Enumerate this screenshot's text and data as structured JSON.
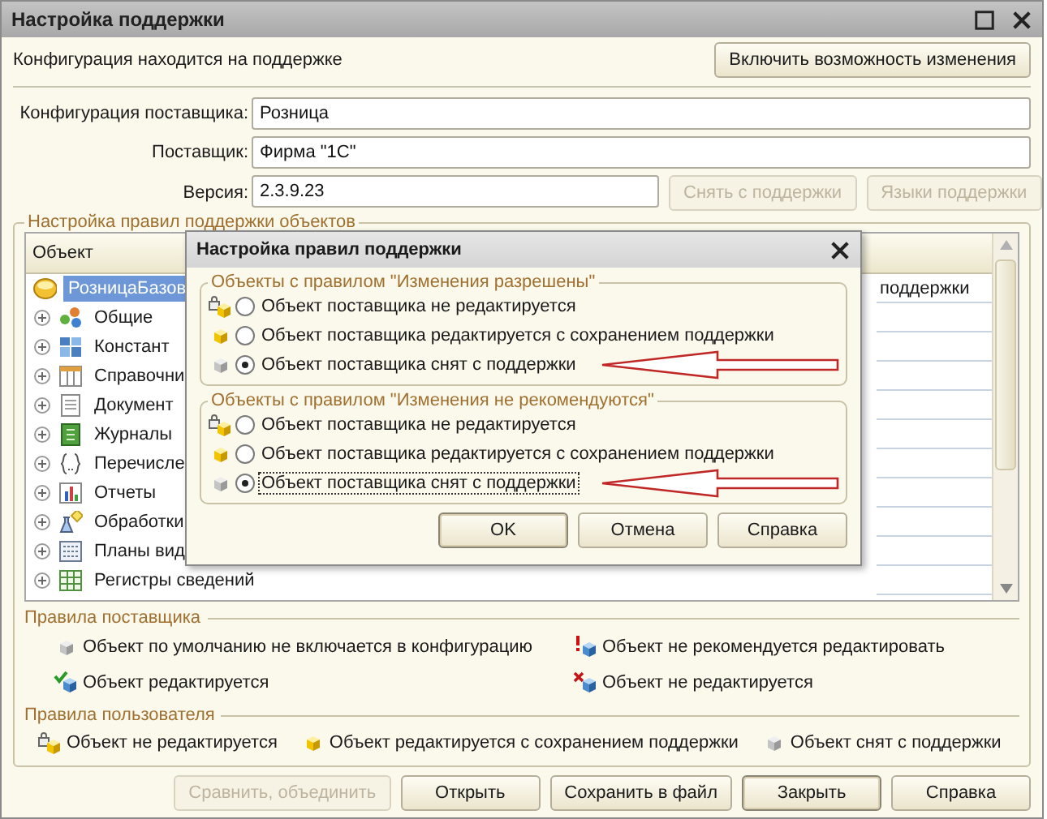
{
  "window": {
    "title": "Настройка поддержки"
  },
  "status_text": "Конфигурация находится на поддержке",
  "enable_button": "Включить возможность изменения",
  "fields": [
    {
      "label": "Конфигурация поставщика:",
      "value": "Розница"
    },
    {
      "label": "Поставщик:",
      "value": "Фирма \"1С\""
    },
    {
      "label": "Версия:",
      "value": "2.3.9.23"
    }
  ],
  "version_buttons": [
    {
      "label": "Снять с поддержки",
      "disabled": true
    },
    {
      "label": "Языки поддержки",
      "disabled": true
    }
  ],
  "rules_group": {
    "title": "Настройка правил поддержки объектов",
    "tree": {
      "columns": [
        "Объект"
      ],
      "rows": [
        {
          "kind": "root",
          "text": "РозницаБазов",
          "column_2": "поддержки",
          "expandable": false,
          "selected": true
        },
        {
          "kind": "common",
          "text": "Общие",
          "expandable": true,
          "selected": false
        },
        {
          "kind": "constants",
          "text": "Констант",
          "expandable": true,
          "selected": false
        },
        {
          "kind": "catalogs",
          "text": "Справочни",
          "expandable": true,
          "selected": false
        },
        {
          "kind": "documents",
          "text": "Документ",
          "expandable": true,
          "selected": false
        },
        {
          "kind": "journals",
          "text": "Журналы",
          "expandable": true,
          "selected": false
        },
        {
          "kind": "enums",
          "text": "Перечисле",
          "expandable": true,
          "selected": false
        },
        {
          "kind": "reports",
          "text": "Отчеты",
          "expandable": true,
          "selected": false
        },
        {
          "kind": "processors",
          "text": "Обработки",
          "expandable": true,
          "selected": false
        },
        {
          "kind": "chart_types",
          "text": "Планы вид",
          "expandable": true,
          "selected": false
        },
        {
          "kind": "registers",
          "text": "Регистры сведений",
          "expandable": true,
          "selected": false
        }
      ]
    },
    "supplier_rules": {
      "title": "Правила поставщика",
      "items": [
        {
          "kind": "excluded",
          "text": "Объект по умолчанию не включается в конфигурацию"
        },
        {
          "kind": "not_recommended",
          "text": "Объект не рекомендуется редактировать"
        },
        {
          "kind": "editable",
          "text": "Объект редактируется"
        },
        {
          "kind": "not_editable",
          "text": "Объект не редактируется"
        }
      ]
    },
    "user_rules": {
      "title": "Правила пользователя",
      "items": [
        {
          "kind": "locked",
          "text": "Объект не редактируется"
        },
        {
          "kind": "kept",
          "text": "Объект редактируется с сохранением поддержки"
        },
        {
          "kind": "removed",
          "text": "Объект снят с поддержки"
        }
      ]
    }
  },
  "footer_buttons": [
    {
      "label": "Сравнить, объединить",
      "disabled": true,
      "default": false
    },
    {
      "label": "Открыть",
      "disabled": false,
      "default": false
    },
    {
      "label": "Сохранить в файл",
      "disabled": false,
      "default": false
    },
    {
      "label": "Закрыть",
      "disabled": false,
      "default": true
    },
    {
      "label": "Справка",
      "disabled": false,
      "default": false
    }
  ],
  "dialog": {
    "title": "Настройка правил поддержки",
    "groups": [
      {
        "title": "Объекты с правилом \"Изменения разрешены\"",
        "options": [
          {
            "kind": "locked",
            "text": "Объект поставщика не редактируется",
            "selected": false,
            "focused": false,
            "arrow": false
          },
          {
            "kind": "kept",
            "text": "Объект поставщика редактируется с сохранением поддержки",
            "selected": false,
            "focused": false,
            "arrow": false
          },
          {
            "kind": "removed",
            "text": "Объект поставщика снят с поддержки",
            "selected": true,
            "focused": false,
            "arrow": true
          }
        ]
      },
      {
        "title": "Объекты с правилом \"Изменения не рекомендуются\"",
        "options": [
          {
            "kind": "locked",
            "text": "Объект поставщика не редактируется",
            "selected": false,
            "focused": false,
            "arrow": false
          },
          {
            "kind": "kept",
            "text": "Объект поставщика редактируется с сохранением поддержки",
            "selected": false,
            "focused": false,
            "arrow": false
          },
          {
            "kind": "removed",
            "text": "Объект поставщика снят с поддержки",
            "selected": true,
            "focused": true,
            "arrow": true
          }
        ]
      }
    ],
    "buttons": [
      {
        "label": "OK",
        "default": true
      },
      {
        "label": "Отмена",
        "default": false
      },
      {
        "label": "Справка",
        "default": false
      }
    ]
  }
}
